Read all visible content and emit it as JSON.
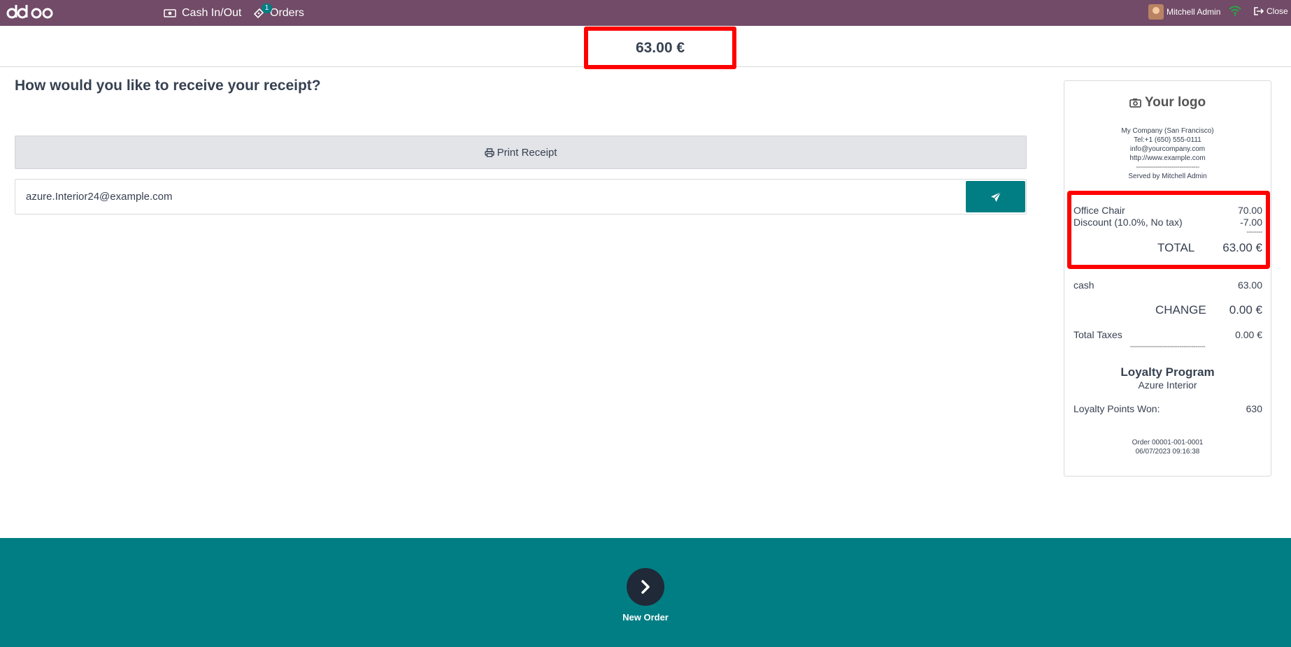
{
  "topbar": {
    "logo_text": "odoo",
    "cash_label": "Cash In/Out",
    "orders_label": "Orders",
    "orders_badge": "1",
    "user_name": "Mitchell Admin",
    "close_label": "Close",
    "colors": {
      "background": "#714b67",
      "badge": "#017e84",
      "wifi": "#28a745"
    }
  },
  "header": {
    "amount": "63.00 €"
  },
  "main": {
    "question": "How would you like to receive your receipt?",
    "print_label": "Print Receipt",
    "email_value": "azure.Interior24@example.com",
    "send_icon": "paper-plane-icon"
  },
  "receipt": {
    "logo_text": "Your logo",
    "company": {
      "name": "My Company (San Francisco)",
      "tel": "Tel:+1 (650) 555-0111",
      "email": "info@yourcompany.com",
      "website": "http://www.example.com",
      "separator": "--------------------------------",
      "served_by": "Served by Mitchell Admin"
    },
    "lines": [
      {
        "name": "Office Chair",
        "amount": "70.00"
      },
      {
        "name": "Discount (10.0%, No tax)",
        "amount": "-7.00"
      }
    ],
    "line_sep": "--------",
    "total_label": "TOTAL",
    "total_value": "63.00 €",
    "payment_label": "cash",
    "payment_value": "63.00",
    "change_label": "CHANGE",
    "change_value": "0.00 €",
    "taxes_label": "Total Taxes",
    "taxes_value": "0.00 €",
    "taxes_sep": "--------------------------------------",
    "loyalty_title": "Loyalty Program",
    "loyalty_customer": "Azure Interior",
    "loyalty_points_label": "Loyalty Points Won:",
    "loyalty_points_value": "630",
    "order_ref": "Order 00001-001-0001",
    "order_date": "06/07/2023 09:16:38"
  },
  "footer": {
    "next_label": "New Order",
    "colors": {
      "background": "#017e84",
      "button": "#1f2937"
    }
  },
  "highlight_color": "#ff0000"
}
